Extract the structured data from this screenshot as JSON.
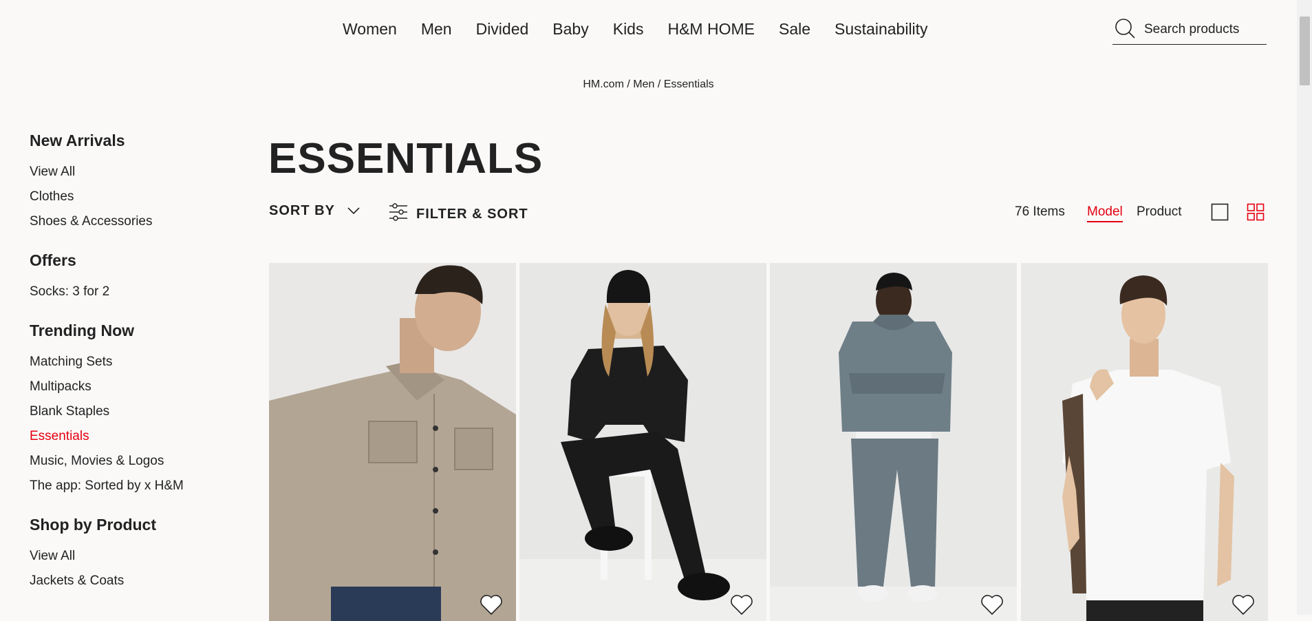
{
  "nav": {
    "links": [
      "Women",
      "Men",
      "Divided",
      "Baby",
      "Kids",
      "H&M HOME",
      "Sale",
      "Sustainability"
    ],
    "search_placeholder": "Search products"
  },
  "breadcrumb": {
    "home": "HM.com",
    "sep1": " / ",
    "section": "Men",
    "sep2": " / ",
    "current": "Essentials"
  },
  "sidebar": {
    "new_arrivals": {
      "heading": "New Arrivals",
      "items": [
        "View All",
        "Clothes",
        "Shoes & Accessories"
      ]
    },
    "offers": {
      "heading": "Offers",
      "items": [
        "Socks: 3 for 2"
      ]
    },
    "trending": {
      "heading": "Trending Now",
      "items": [
        "Matching Sets",
        "Multipacks",
        "Blank Staples",
        "Essentials",
        "Music, Movies & Logos",
        "The app: Sorted by x H&M"
      ],
      "active_index": 3
    },
    "shop_by_product": {
      "heading": "Shop by Product",
      "items": [
        "View All",
        "Jackets & Coats"
      ]
    }
  },
  "page": {
    "title": "ESSENTIALS",
    "sort_label": "SORT BY",
    "filter_label": "FILTER & SORT",
    "items_count": "76 Items",
    "view_model": "Model",
    "view_product": "Product"
  },
  "colors": {
    "accent": "#e50010",
    "text": "#222222",
    "background": "#faf9f8"
  },
  "products": [
    {
      "image": "man in beige overshirt",
      "shirt_color": "#b3a594"
    },
    {
      "image": "man in black sweatshirt sitting on stool",
      "shirt_color": "#1a1a1a"
    },
    {
      "image": "man in grey hoodie and joggers",
      "shirt_color": "#6f7f88"
    },
    {
      "image": "man in white t-shirt",
      "shirt_color": "#f7f7f7"
    }
  ],
  "icons": {
    "search": "search-icon",
    "chevron": "chevron-down-icon",
    "filter": "filter-sliders-icon",
    "heart": "heart-icon",
    "grid_single": "single-view-icon",
    "grid_multi": "grid-view-icon"
  }
}
